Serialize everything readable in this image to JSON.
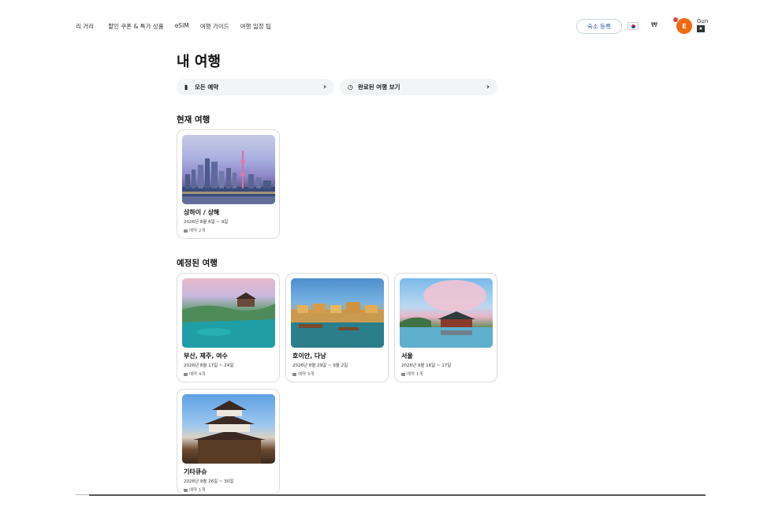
{
  "nav": {
    "links": [
      "리 거리",
      "할인 쿠폰 & 특가 상품",
      "eSIM",
      "여행 가이드",
      "여행 일정 팁"
    ],
    "host_button": "숙소 등록",
    "currency": "₩",
    "avatar_initial": "E",
    "user_tag": "Gun"
  },
  "page": {
    "title": "내 여행"
  },
  "filters": {
    "all": "모든 예약",
    "completed": "완료된 여행 보기"
  },
  "sections": {
    "current": "현재 여행",
    "upcoming": "예정된 여행"
  },
  "trips": {
    "shanghai": {
      "name": "상하이 / 상해",
      "dates": "2026년 8월 6일 ~ 9일",
      "count": "예약 2개"
    },
    "busan": {
      "name": "부산, 제주, 여수",
      "dates": "2026년 8월 17일 ~ 24일",
      "count": "예약 4개"
    },
    "hoian": {
      "name": "호이안, 다낭",
      "dates": "2026년 8월 29일 ~ 9월 2일",
      "count": "예약 3개"
    },
    "seoul": {
      "name": "서울",
      "dates": "2026년 9월 16일 ~ 17일",
      "count": "예약 1개"
    },
    "kitakyushu": {
      "name": "기타큐슈",
      "dates": "2026년 9월 26일 ~ 30일",
      "count": "예약 1개"
    }
  },
  "colors": {
    "accent": "#f06a0f",
    "host_button_text": "#2a4fa8",
    "filter_bg": "#f3f4f6"
  }
}
